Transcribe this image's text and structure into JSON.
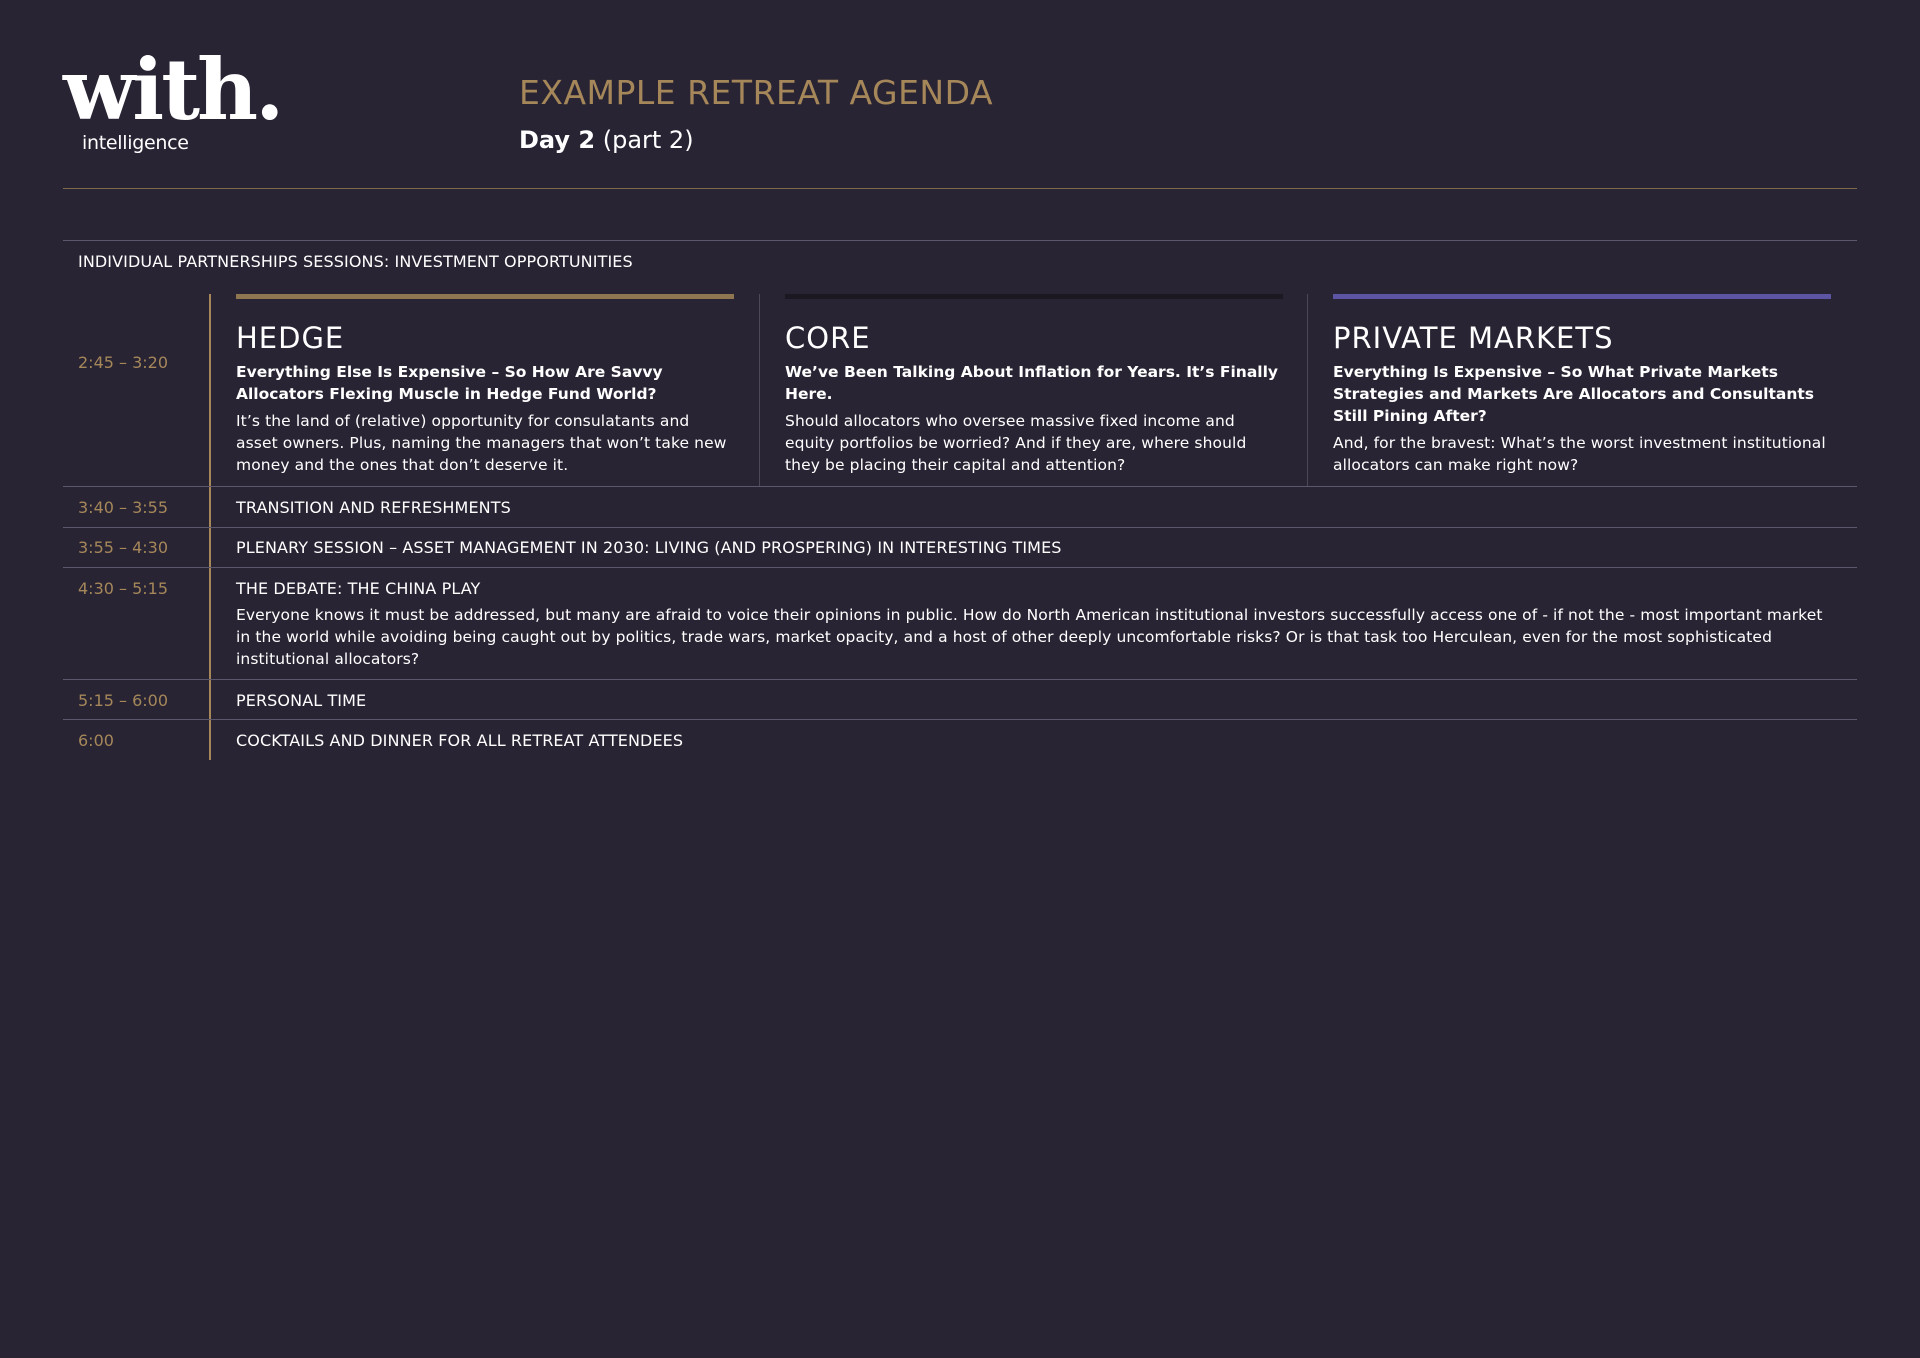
{
  "logo": {
    "word": "with.",
    "sub": "intelligence"
  },
  "header": {
    "title": "EXAMPLE RETREAT AGENDA",
    "day_bold": "Day 2",
    "day_rest": "(part 2)"
  },
  "section_header": "INDIVIDUAL PARTNERSHIPS SESSIONS: INVESTMENT OPPORTUNITIES",
  "colors": {
    "background": "#292433",
    "gold": "#a5875a",
    "hedge_bar": "#8d7650",
    "core_bar": "#1b1822",
    "private_bar": "#5b55a3"
  },
  "partnership": {
    "time": "2:45 – 3:20",
    "columns": [
      {
        "title": "HEDGE",
        "subtitle": "Everything Else Is Expensive – So How Are Savvy Allocators Flexing Muscle in Hedge Fund World?",
        "body": "It’s the land of (relative) opportunity for consulatants and asset owners. Plus, naming the managers that won’t take new money and the ones that don’t deserve it."
      },
      {
        "title": "CORE",
        "subtitle": "We’ve Been Talking About Inflation for Years. It’s Finally Here.",
        "body": "Should allocators who oversee massive fixed income and equity portfolios be worried? And if they are, where should they be placing their capital and attention?"
      },
      {
        "title": "PRIVATE MARKETS",
        "subtitle": "Everything Is Expensive – So What Private Markets Strategies and Markets Are Allocators and Consultants Still Pining After?",
        "body": "And, for the bravest: What’s the worst investment institutional allocators can make right now?"
      }
    ]
  },
  "rows": [
    {
      "time": "3:40 – 3:55",
      "label": "TRANSITION AND REFRESHMENTS"
    },
    {
      "time": "3:55 – 4:30",
      "label": "PLENARY SESSION – ASSET MANAGEMENT IN 2030:  LIVING (AND PROSPERING) IN INTERESTING TIMES"
    },
    {
      "time": "4:30 – 5:15",
      "label": "THE DEBATE: THE CHINA PLAY",
      "body": "Everyone knows it must be addressed, but many are afraid to voice their opinions in public. How do North American institutional investors successfully access one of - if not the - most important market in the world while avoiding being caught out by politics, trade wars, market opacity, and a host of other deeply uncomfortable risks? Or is that task too Herculean, even for the most sophisticated institutional allocators?"
    },
    {
      "time": "5:15 – 6:00",
      "label": "PERSONAL TIME"
    },
    {
      "time": "6:00",
      "label": "COCKTAILS AND DINNER FOR ALL RETREAT ATTENDEES"
    }
  ]
}
